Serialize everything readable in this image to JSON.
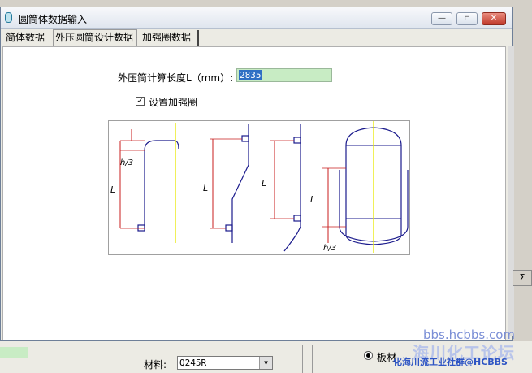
{
  "window": {
    "title": "圆筒体数据输入",
    "minimize_glyph": "—",
    "maximize_glyph": "▫",
    "close_glyph": "✕"
  },
  "tabs": [
    {
      "label": "简体数据"
    },
    {
      "label": "外压圆筒设计数据"
    },
    {
      "label": "加强圈数据"
    }
  ],
  "form": {
    "length_label": "外压筒计算长度L（mm）:",
    "length_value": "2835",
    "reinforce_checkbox_mark": "✓",
    "reinforce_label": "设置加强圈"
  },
  "diagram": {
    "labels": [
      "L",
      "h/3",
      "L",
      "L",
      "L",
      "h/3"
    ],
    "line_color": "#1a1a8c",
    "dim_color": "#c81e1e",
    "axis_color": "#e8e800"
  },
  "bottom": {
    "material_label": "材料:",
    "material_value": "Q245R",
    "radio_label": "板材",
    "right_ctrl_label": "Σ"
  },
  "watermark": {
    "line1": "bbs.hcbbs.com",
    "line2": "海川化工论坛",
    "line3": "化海川流工业社群@HCBBS"
  }
}
